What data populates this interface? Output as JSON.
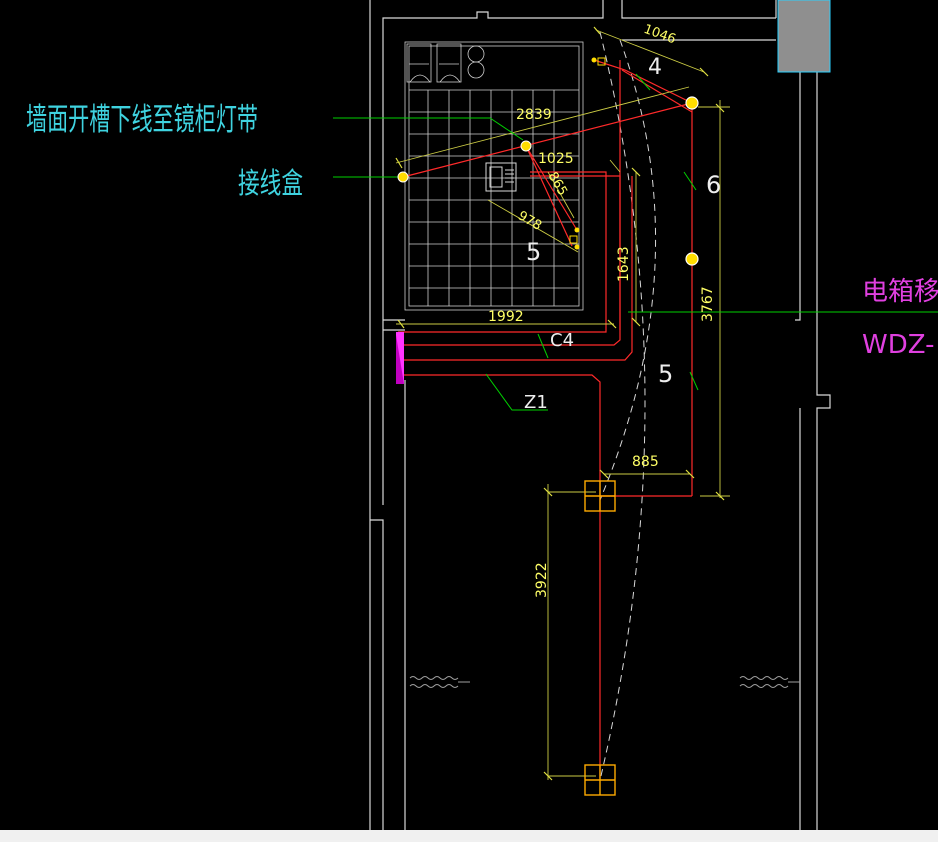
{
  "annotations": {
    "wall_slot_note": "墙面开槽下线至镜柜灯带",
    "junction_box": "接线盒",
    "panel_relocate": "电箱移位",
    "panel_code": "WDZ-"
  },
  "dimensions": {
    "d1046": "1046",
    "d2839": "2839",
    "d1025": "1025",
    "d865": "865",
    "d978": "978",
    "d1643": "1643",
    "d3767": "3767",
    "d1992": "1992",
    "d885": "885",
    "d3922": "3922"
  },
  "circuits": {
    "n4": "4",
    "n6": "6",
    "n5_left": "5",
    "n5_right": "5",
    "c4": "C4",
    "z1": "Z1"
  },
  "colors": {
    "background": "#000000",
    "wall": "#d9d9d9",
    "wire": "#ff2a2a",
    "dimension": "#ffff66",
    "leader": "#00d000",
    "cyan_text": "#3fd3e0",
    "magenta": "#ff33ff",
    "tile_grid": "#cfcfcf",
    "block": "#8f8f8f"
  }
}
